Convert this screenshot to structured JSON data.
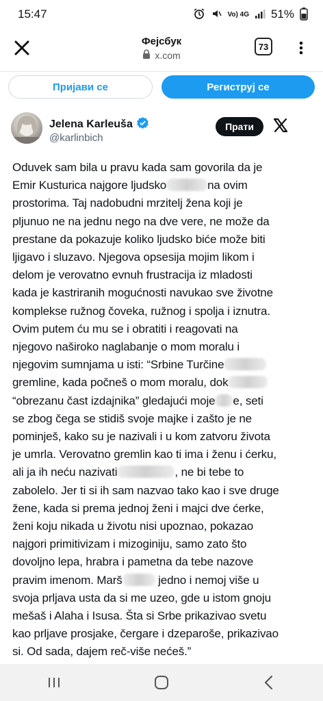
{
  "status_bar": {
    "time": "15:47",
    "network": "Vo) 4G",
    "battery": "51%"
  },
  "app_bar": {
    "title": "Фејсбук",
    "domain": "x.com",
    "tab_count": "73"
  },
  "auth": {
    "login_label": "Пријави се",
    "signup_label": "Региструј се"
  },
  "tweet": {
    "author_name": "Jelena Karleuša",
    "author_handle": "@karlinbich",
    "follow_label": "Прати",
    "lines": [
      "Oduvek sam bila u pravu kada sam govorila da je",
      "Emir Kusturica najgore ljudsko",
      "na ovim",
      "prostorima. Taj nadobudni mrzitelj žena koji je",
      "pljunuo ne na jednu nego na dve vere, ne može da",
      "prestane da pokazuje koliko ljudsko biće može biti",
      "ljigavo i sluzavo. Njegova opsesija mojim likom i",
      "delom je verovatno evnuh frustracija iz mladosti",
      "kada je kastriranih mogućnosti navukao sve životne",
      "komplekse ružnog čoveka, ružnog i spolja i iznutra.",
      "Ovim putem ću mu se i obratiti i reagovati na",
      "njegovo naširoko naglabanje o mom moralu i",
      "njegovim sumnjama u isti: “Srbine Turčine",
      "gremline, kada počneš o mom moralu, dok",
      "“obrezanu čast izdajnika” gledajući moje",
      "e, seti",
      "se zbog čega se stidiš svoje majke i zašto je ne",
      "pominješ, kako su je nazivali i u kom zatvoru života",
      "je umrla. Verovatno gremlin kao ti ima i ženu i ćerku,",
      "ali ja ih neću nazivati",
      ", ne bi tebe to",
      "zabolelo. Jer ti si ih sam nazvao tako kao i sve druge",
      "žene, kada si prema jednoj ženi i majci dve ćerke,",
      "ženi koju nikada u životu nisi upoznao, pokazao",
      "najgori primitivizam i mizoginiju, samo zato što",
      "dovoljno lepa, hrabra i pametna da tebe nazove",
      "pravim imenom. Marš",
      "jedno i nemoj više u",
      "svoja prljava usta da si me uzeo, gde u istom gnoju",
      "mešaš i Alaha i Isusa. Šta si Srbe prikazivao svetu",
      "kao prljave prosjake, čergare i dzeparoše, prikazivao",
      "si. Od sada, dajem reč-više nećeš.”"
    ]
  },
  "colors": {
    "accent": "#1d9bf0",
    "text": "#0f1419",
    "secondary_text": "#536471",
    "follow_bg": "#0f1419"
  }
}
